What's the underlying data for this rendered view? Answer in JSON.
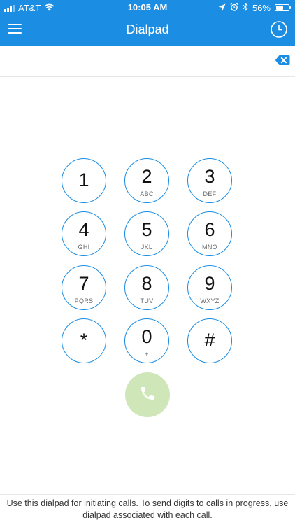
{
  "status_bar": {
    "carrier": "AT&T",
    "time": "10:05 AM",
    "battery_percent": "56%",
    "battery_level": 0.56,
    "icons": [
      "signal-icon",
      "wifi-icon",
      "location-icon",
      "alarm-icon",
      "bluetooth-icon",
      "battery-icon"
    ]
  },
  "nav": {
    "title": "Dialpad",
    "menu_icon": "hamburger-menu-icon",
    "history_icon": "clock-icon"
  },
  "number_field": {
    "value": "",
    "clear_icon": "backspace-icon"
  },
  "keypad": {
    "keys": [
      {
        "digit": "1",
        "letters": ""
      },
      {
        "digit": "2",
        "letters": "ABC"
      },
      {
        "digit": "3",
        "letters": "DEF"
      },
      {
        "digit": "4",
        "letters": "GHI"
      },
      {
        "digit": "5",
        "letters": "JKL"
      },
      {
        "digit": "6",
        "letters": "MNO"
      },
      {
        "digit": "7",
        "letters": "PQRS"
      },
      {
        "digit": "8",
        "letters": "TUV"
      },
      {
        "digit": "9",
        "letters": "WXYZ"
      },
      {
        "digit": "*",
        "letters": ""
      },
      {
        "digit": "0",
        "letters": "+"
      },
      {
        "digit": "#",
        "letters": ""
      }
    ]
  },
  "call_button": {
    "icon": "phone-icon",
    "color": "#cfe7b8"
  },
  "footer": {
    "hint": "Use this dialpad for initiating calls. To send digits to calls in progress, use dialpad associated with each call."
  },
  "colors": {
    "accent": "#1b8de3",
    "call_disabled": "#cfe7b8"
  }
}
